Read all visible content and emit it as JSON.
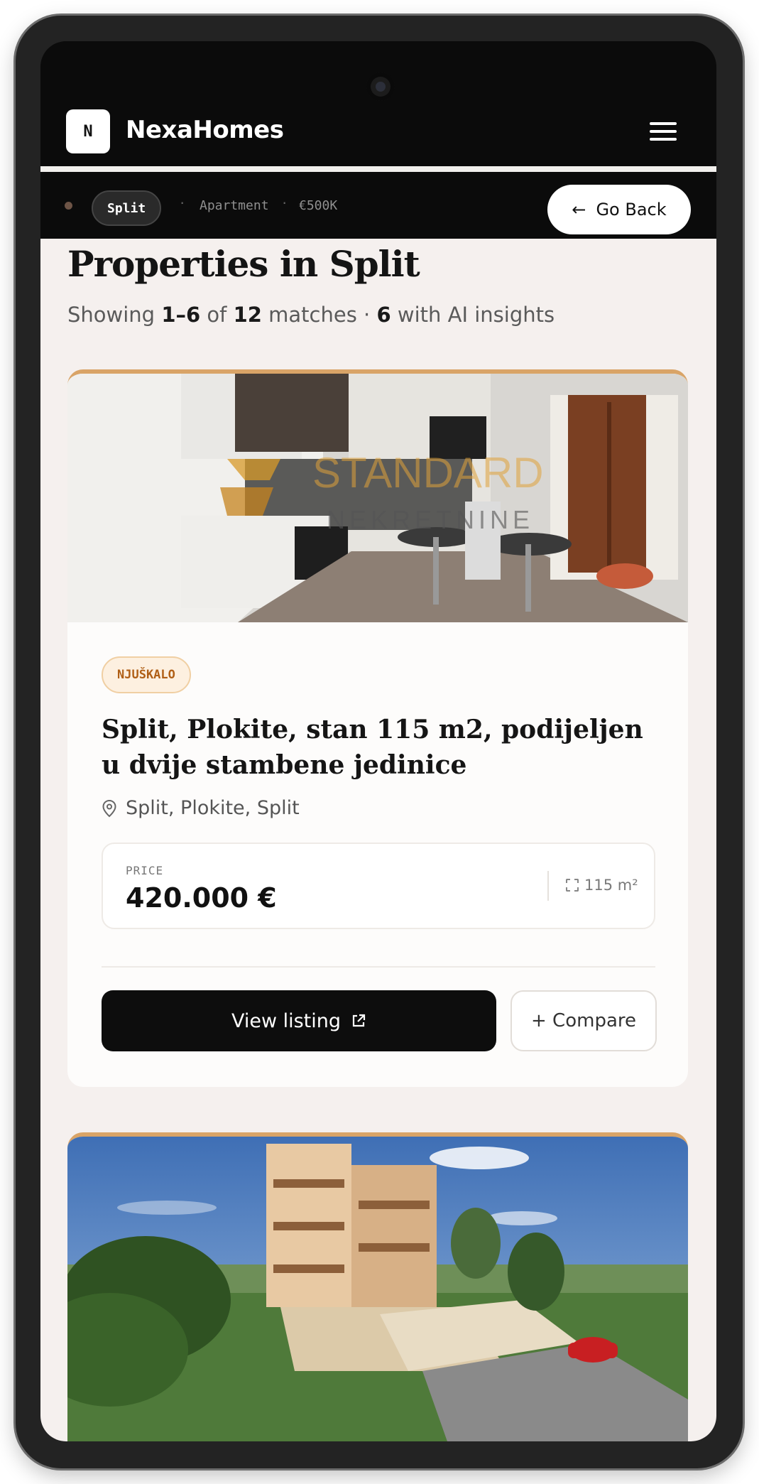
{
  "header": {
    "logo_letter": "N",
    "brand": "NexaHomes"
  },
  "filters": {
    "city": "Split",
    "type": "Apartment",
    "budget": "€500K",
    "go_back_label": "Go Back"
  },
  "results": {
    "title": "Properties in Split",
    "summary_prefix": "Showing",
    "range": "1–6",
    "of": "of",
    "total": "12",
    "matches_suffix": "matches ·",
    "insights_count": "6",
    "insights_suffix": "with AI insights"
  },
  "listing": {
    "photo_watermark_top": "STANDARD",
    "photo_watermark_bottom": "NEKRETNINE",
    "source": "NJUŠKALO",
    "title": "Split, Plokite, stan 115 m2, podijeljen u dvije stambene jedinice",
    "location": "Split, Plokite, Split",
    "price_label": "PRICE",
    "price": "420.000 €",
    "area": "115 m²",
    "view_label": "View listing",
    "compare_label": "+ Compare"
  },
  "colors": {
    "accent": "#d9a467",
    "badge_text": "#b05f16",
    "background": "#f5f0ee"
  }
}
